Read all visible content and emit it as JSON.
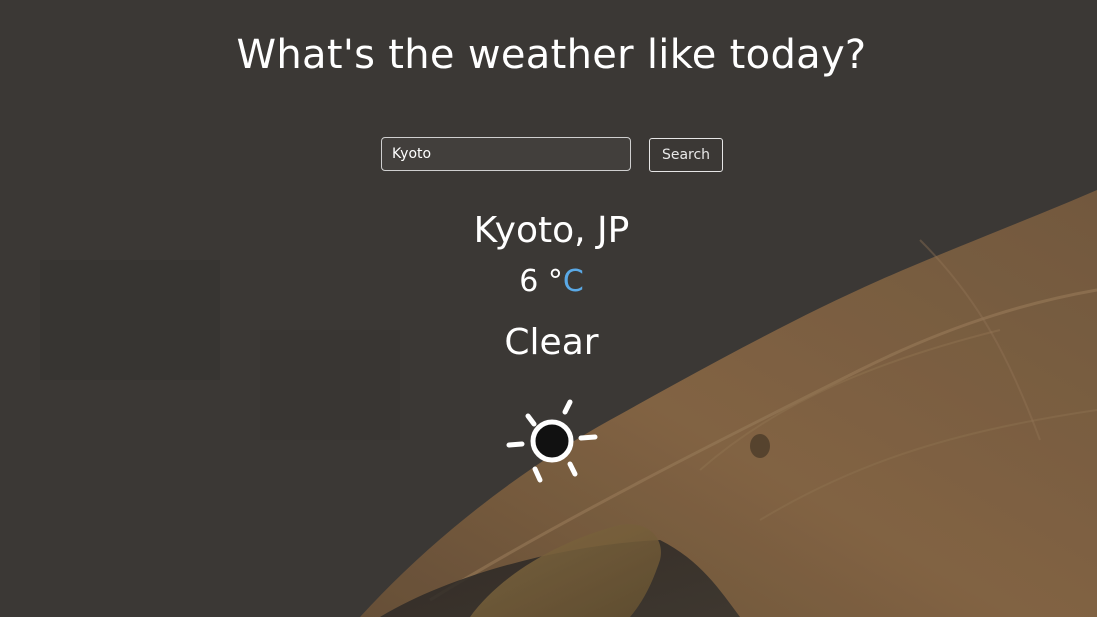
{
  "header": {
    "title": "What's the weather like today?"
  },
  "search": {
    "value": "Kyoto",
    "button_label": "Search"
  },
  "weather": {
    "location": "Kyoto, JP",
    "temperature": "6",
    "degree_symbol": "°",
    "unit": "C",
    "condition": "Clear",
    "icon": "sun-icon"
  },
  "colors": {
    "unit_accent": "#5aa9e6",
    "text": "#ffffff",
    "background_overlay": "#403d3a",
    "leaf": "#8a6a48"
  }
}
